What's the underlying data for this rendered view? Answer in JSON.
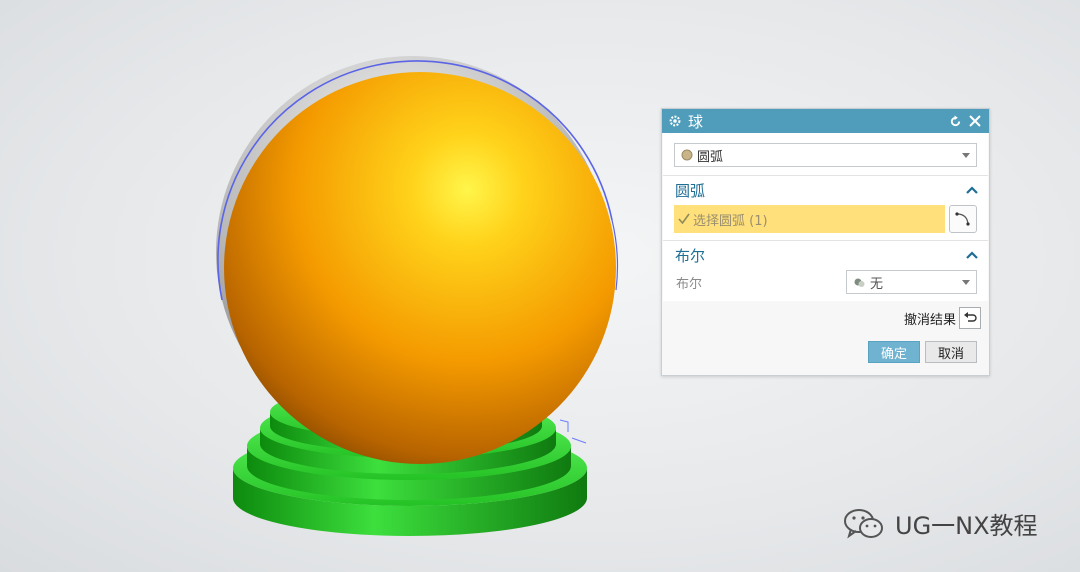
{
  "dialog": {
    "title": "球",
    "type_select": {
      "value": "圆弧",
      "icon": "arc-type-icon"
    },
    "arc_group": {
      "header": "圆弧",
      "select_label": "选择圆弧 (1)"
    },
    "bool_group": {
      "header": "布尔",
      "field_label": "布尔",
      "value": "无"
    },
    "undo_label": "撤消结果",
    "ok_label": "确定",
    "cancel_label": "取消"
  },
  "watermark": {
    "text": "UG一NX教程"
  },
  "colors": {
    "title_bar": "#4f9dbb",
    "group_header": "#1f6f95",
    "selection_highlight": "#ffe07a",
    "sphere": "#f7a600",
    "base": "#1fb51f",
    "ok_button": "#6fb3d1"
  }
}
